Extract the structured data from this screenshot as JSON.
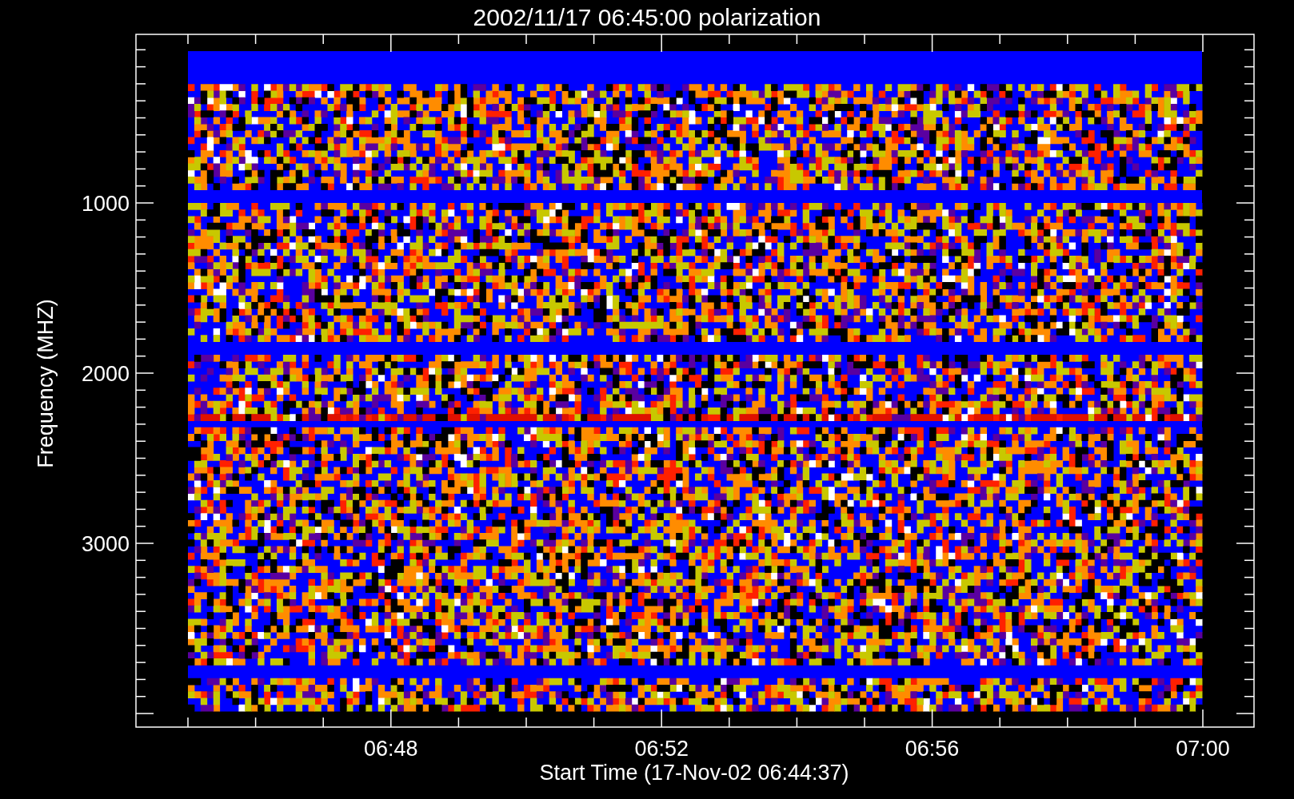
{
  "title": "2002/11/17 06:45:00 polarization",
  "y_axis": {
    "label": "Frequency (MHZ)",
    "ticks": [
      "1000",
      "2000",
      "3000"
    ]
  },
  "x_axis": {
    "label": "Start Time (17-Nov-02 06:44:37)",
    "ticks": [
      "06:48",
      "06:52",
      "06:56",
      "07:00"
    ]
  }
}
